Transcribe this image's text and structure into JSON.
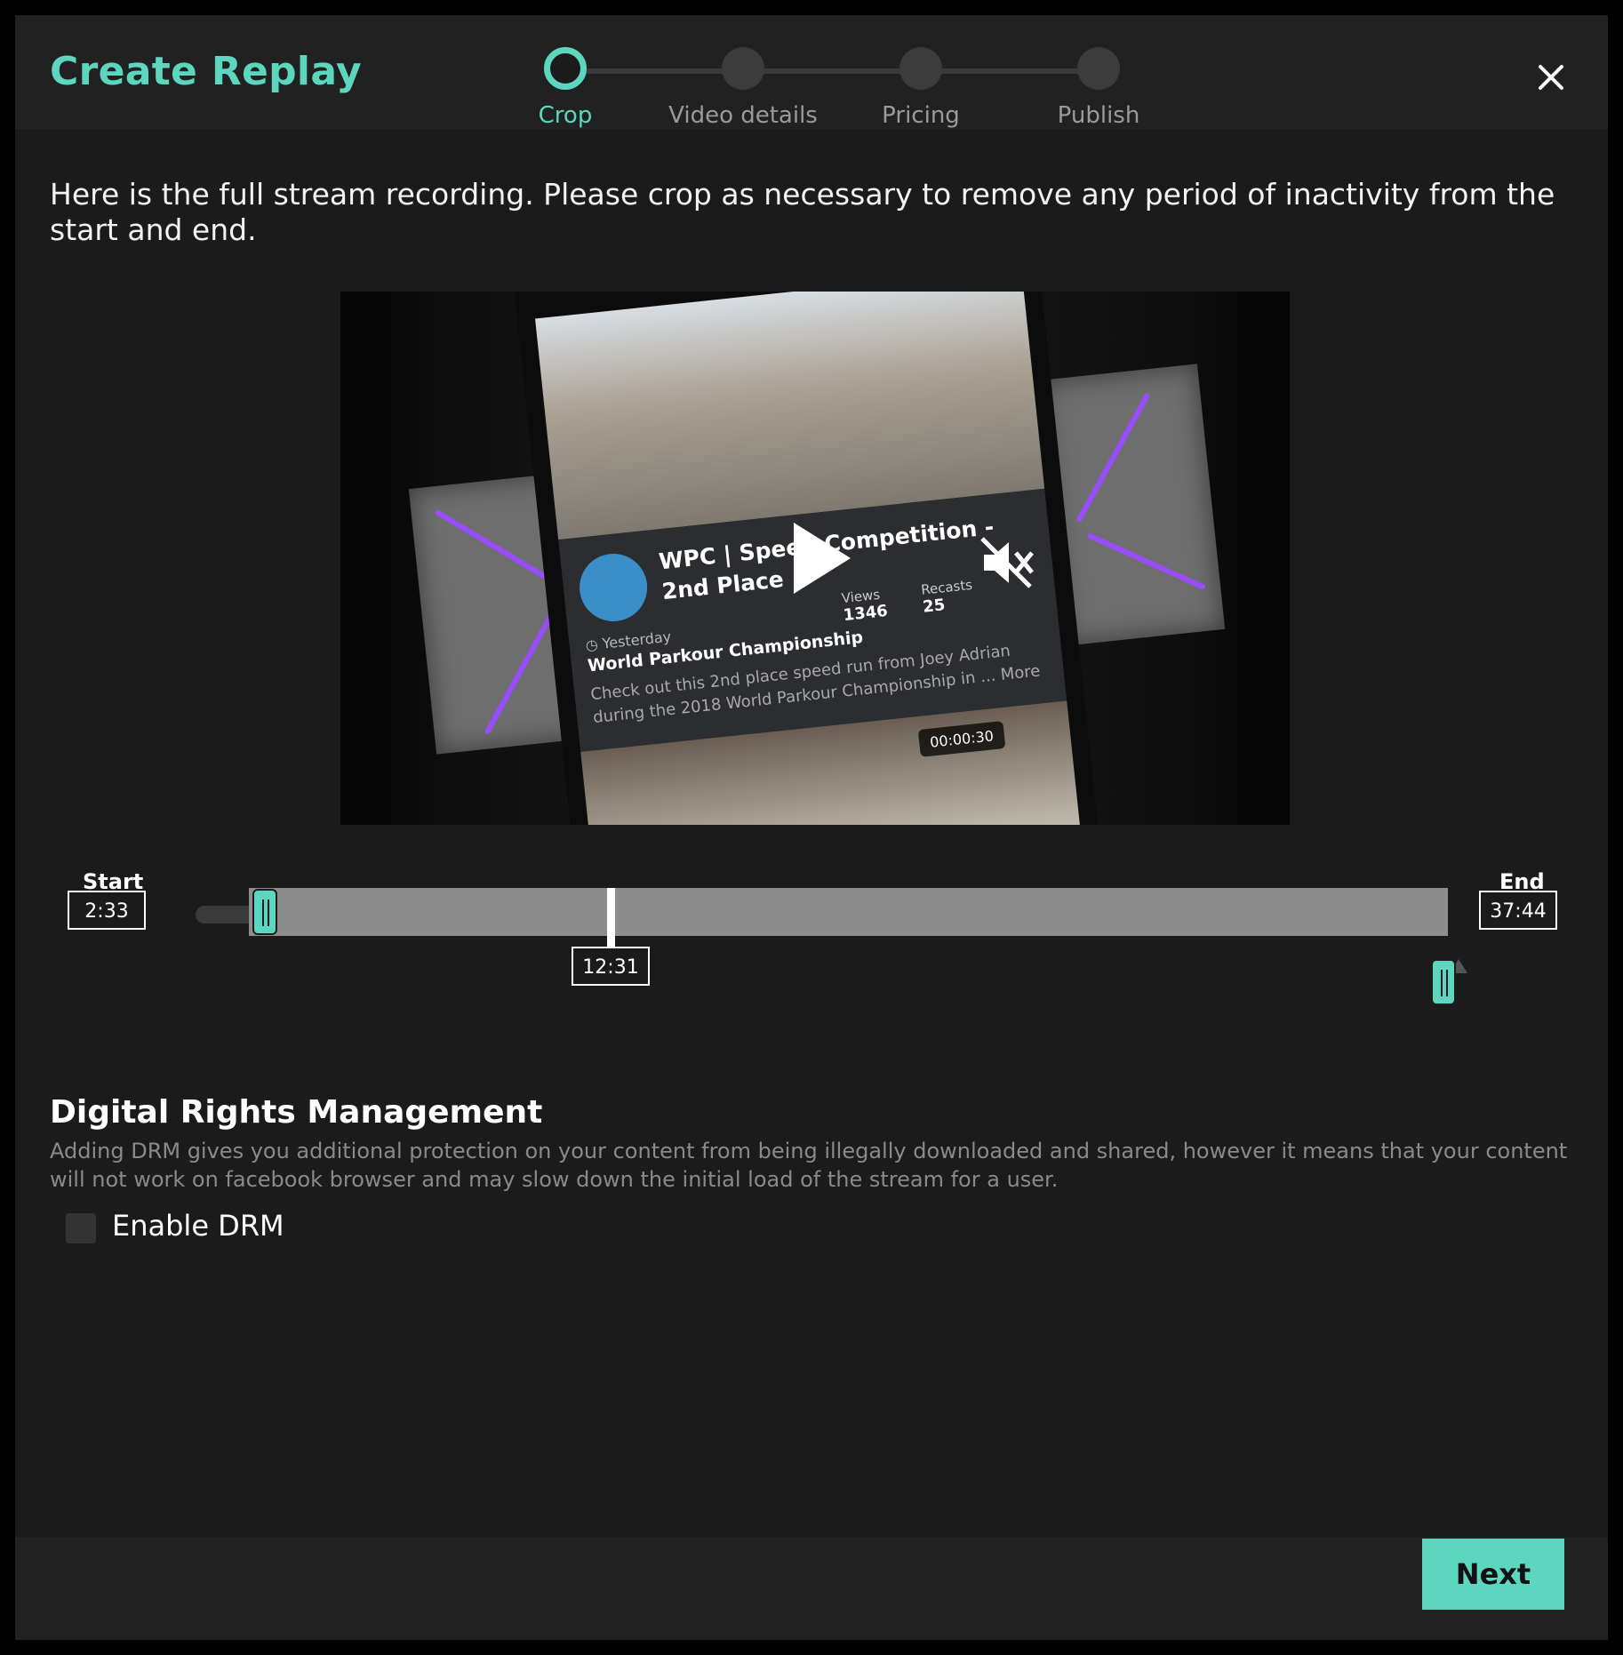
{
  "header": {
    "title": "Create Replay",
    "steps": [
      {
        "label": "Crop",
        "active": true
      },
      {
        "label": "Video details",
        "active": false
      },
      {
        "label": "Pricing",
        "active": false
      },
      {
        "label": "Publish",
        "active": false
      }
    ],
    "close_icon": "close-icon"
  },
  "intro_text": "Here is the full stream recording. Please crop as necessary to remove any period of inactivity from the start and end.",
  "video": {
    "card_title": "WPC | Speed Competition - 2nd Place",
    "posted": "Yesterday",
    "channel": "World Parkour Championship",
    "description": "Check out this 2nd place speed run from Joey Adrian during the 2018 World Parkour Championship in ... More",
    "views_label": "Views",
    "views": "1346",
    "recasts_label": "Recasts",
    "recasts": "25",
    "thumb_duration": "00:00:30",
    "play_icon": "play-icon",
    "mute_icon": "volume-muted-icon"
  },
  "crop": {
    "start_label": "Start",
    "start_time": "2:33",
    "end_label": "End",
    "end_time": "37:44",
    "playhead_time": "12:31"
  },
  "drm": {
    "title": "Digital Rights Management",
    "description": "Adding DRM gives you additional protection on your content from being illegally downloaded and shared, however it means that your content will not work on facebook browser and may slow down the initial load of the stream for a user.",
    "checkbox_label": "Enable DRM",
    "enabled": false
  },
  "footer": {
    "next_label": "Next"
  },
  "colors": {
    "accent": "#5dd6c0",
    "background": "#1b1b1b",
    "header": "#212121",
    "track": "#8d8d8d"
  }
}
